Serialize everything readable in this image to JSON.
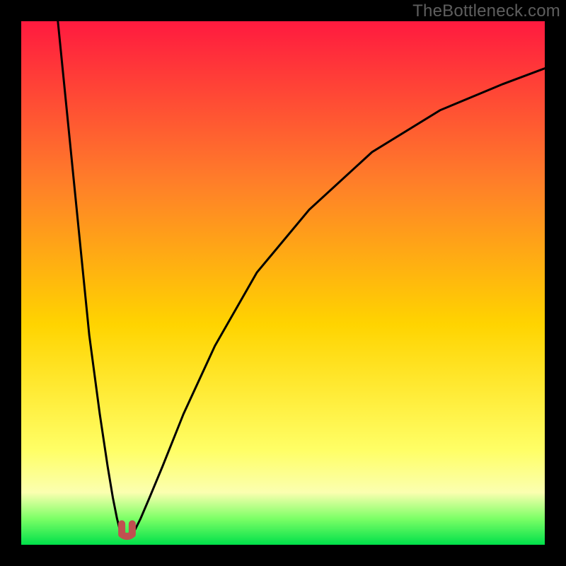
{
  "watermark": "TheBottleneck.com",
  "colors": {
    "frame": "#000000",
    "grad_top": "#ff1a3f",
    "grad_mid_upper": "#ff7c2a",
    "grad_mid": "#ffd400",
    "grad_lower": "#ffff66",
    "grad_lowest": "#fbffb0",
    "grad_green_light": "#7cff66",
    "grad_green": "#00e04a",
    "curve_stroke": "#000000",
    "marker_fill": "#c05050",
    "marker_stroke": "#b03838"
  },
  "chart_data": {
    "type": "line",
    "title": "",
    "xlabel": "",
    "ylabel": "",
    "xlim": [
      0,
      100
    ],
    "ylim": [
      0,
      100
    ],
    "note": "x and y are normalized 0-100 across the plot area; y=0 is bottom, y=100 is top. Values are estimates read from the gradient rows and curve geometry.",
    "series": [
      {
        "name": "left-branch",
        "x": [
          7,
          9,
          11,
          13,
          15,
          16.5,
          17.5,
          18.3,
          18.8,
          19.2
        ],
        "y": [
          100,
          80,
          60,
          40,
          25,
          15,
          9,
          5,
          3,
          2
        ]
      },
      {
        "name": "right-branch",
        "x": [
          21.2,
          21.8,
          22.8,
          24.5,
          27,
          31,
          37,
          45,
          55,
          67,
          80,
          92,
          100
        ],
        "y": [
          2,
          3,
          5,
          9,
          15,
          25,
          38,
          52,
          64,
          75,
          83,
          88,
          91
        ]
      }
    ],
    "marker": {
      "name": "minimum-marker",
      "shape": "u",
      "x_center": 20.2,
      "x_half_width": 1.0,
      "y_top": 4.0,
      "y_bottom": 1.2
    },
    "gradient_stops_pct_from_top": [
      {
        "pct": 0,
        "color": "#ff1a3f"
      },
      {
        "pct": 30,
        "color": "#ff7c2a"
      },
      {
        "pct": 58,
        "color": "#ffd400"
      },
      {
        "pct": 82,
        "color": "#ffff66"
      },
      {
        "pct": 90,
        "color": "#fbffb0"
      },
      {
        "pct": 95,
        "color": "#7cff66"
      },
      {
        "pct": 100,
        "color": "#00e04a"
      }
    ]
  }
}
